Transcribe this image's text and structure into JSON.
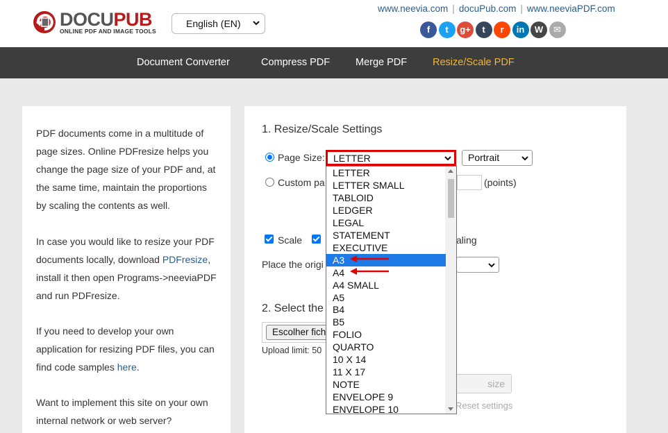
{
  "header": {
    "logo": {
      "brand_main": "DOCU",
      "brand_accent": "PUB",
      "tagline": "ONLINE PDF AND IMAGE TOOLS"
    },
    "language": {
      "selected": "English (EN)"
    },
    "links": [
      "www.neevia.com",
      "docuPub.com",
      "www.neeviaPDF.com"
    ],
    "social": [
      {
        "name": "facebook-icon",
        "glyph": "f",
        "color": "#3b5998"
      },
      {
        "name": "twitter-icon",
        "glyph": "t",
        "color": "#1da1f2"
      },
      {
        "name": "google-plus-icon",
        "glyph": "g+",
        "color": "#dd4b39"
      },
      {
        "name": "tumblr-icon",
        "glyph": "t",
        "color": "#35465c"
      },
      {
        "name": "reddit-icon",
        "glyph": "r",
        "color": "#ff4500"
      },
      {
        "name": "linkedin-icon",
        "glyph": "in",
        "color": "#0077b5"
      },
      {
        "name": "wordpress-icon",
        "glyph": "W",
        "color": "#464646"
      },
      {
        "name": "email-icon",
        "glyph": "✉",
        "color": "#aaaaaa"
      }
    ]
  },
  "nav": {
    "items": [
      {
        "label": "Document Converter",
        "active": false
      },
      {
        "label": "Compress PDF",
        "active": false
      },
      {
        "label": "Merge PDF",
        "active": false
      },
      {
        "label": "Resize/Scale PDF",
        "active": true
      }
    ]
  },
  "left_panel": {
    "p1": "PDF documents come in a multitude of page sizes. Online PDFresize helps you change the page size of your PDF and, at the same time, maintain the proportions by scaling the contents as well.",
    "p2_before": "In case you would like to resize your PDF documents locally, download ",
    "p2_link": "PDFresize",
    "p2_after": ", install it then open Programs->neeviaPDF and run PDFresize.",
    "p3_before": "If you need to develop your own application for resizing PDF files, you can find code samples ",
    "p3_link": "here",
    "p3_after": ".",
    "p4": "Want to implement this site on your own internal network or web server?"
  },
  "settings": {
    "section1_title": "1. Resize/Scale Settings",
    "page_size_label": "Page Size:",
    "page_size_value": "LETTER",
    "orientation_value": "Portrait",
    "custom_label_visible": "Custom pa",
    "points_label": "(points)",
    "scale_label": "Scale",
    "scaling_label_partial": "aling",
    "place_label_partial": "Place the origi",
    "section2_title_partial": "2. Select the",
    "file_button_partial": "Escolher fich",
    "upload_limit_partial": "Upload limit: 50",
    "resize_button_partial": "size",
    "reset_label_partial": "Reset settings"
  },
  "page_size_options": [
    "LETTER",
    "LETTER SMALL",
    "TABLOID",
    "LEDGER",
    "LEGAL",
    "STATEMENT",
    "EXECUTIVE",
    "A3",
    "A4",
    "A4 SMALL",
    "A5",
    "B4",
    "B5",
    "FOLIO",
    "QUARTO",
    "10 X 14",
    "11 X 17",
    "NOTE",
    "ENVELOPE 9",
    "ENVELOPE 10"
  ],
  "highlighted_option": "A3",
  "accent_colors": {
    "nav_active": "#f2b632",
    "annotation_red": "#e00000",
    "option_highlight": "#1e7ae6"
  }
}
